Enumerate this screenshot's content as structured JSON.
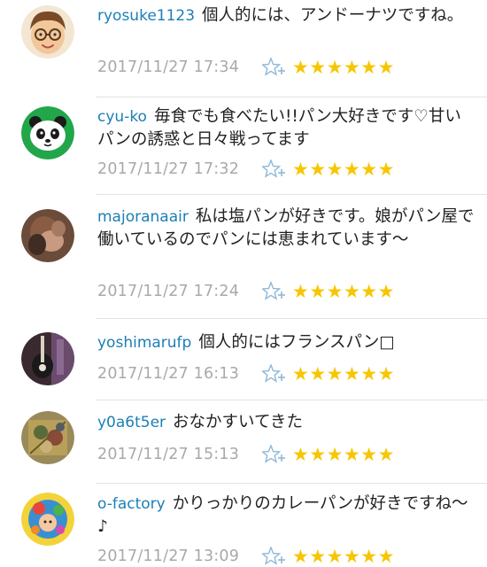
{
  "comments": [
    {
      "username": "ryosuke1123",
      "text": "個人的には、アンドーナツですね。",
      "timestamp": "2017/11/27 17:34",
      "stars": "★★★★★★",
      "avatar_icon": "cartoon-boy-glasses-avatar"
    },
    {
      "username": "cyu-ko",
      "text": "毎食でも食べたい!!パン大好きです♡甘いパンの誘惑と日々戦ってます",
      "timestamp": "2017/11/27 17:32",
      "stars": "★★★★★★",
      "avatar_icon": "panda-avatar"
    },
    {
      "username": "majoranaair",
      "text": "私は塩パンが好きです。娘がパン屋で働いているのでパンには恵まれています～",
      "timestamp": "2017/11/27 17:24",
      "stars": "★★★★★★",
      "avatar_icon": "photo-avatar"
    },
    {
      "username": "yoshimarufp",
      "text": "個人的にはフランスパン□",
      "timestamp": "2017/11/27 16:13",
      "stars": "★★★★★★",
      "avatar_icon": "guitar-photo-avatar"
    },
    {
      "username": "y0a6t5er",
      "text": "おなかすいてきた",
      "timestamp": "2017/11/27 15:13",
      "stars": "★★★★★★",
      "avatar_icon": "illustration-avatar"
    },
    {
      "username": "o-factory",
      "text": "かりっかりのカレーパンが好きですね～♪",
      "timestamp": "2017/11/27 13:09",
      "stars": "★★★★★★",
      "avatar_icon": "colorful-character-avatar"
    }
  ],
  "colors": {
    "username": "#1c7fb6",
    "timestamp": "#a9a9a9",
    "star": "#f7c600",
    "add_star": "#8fb8d8"
  }
}
